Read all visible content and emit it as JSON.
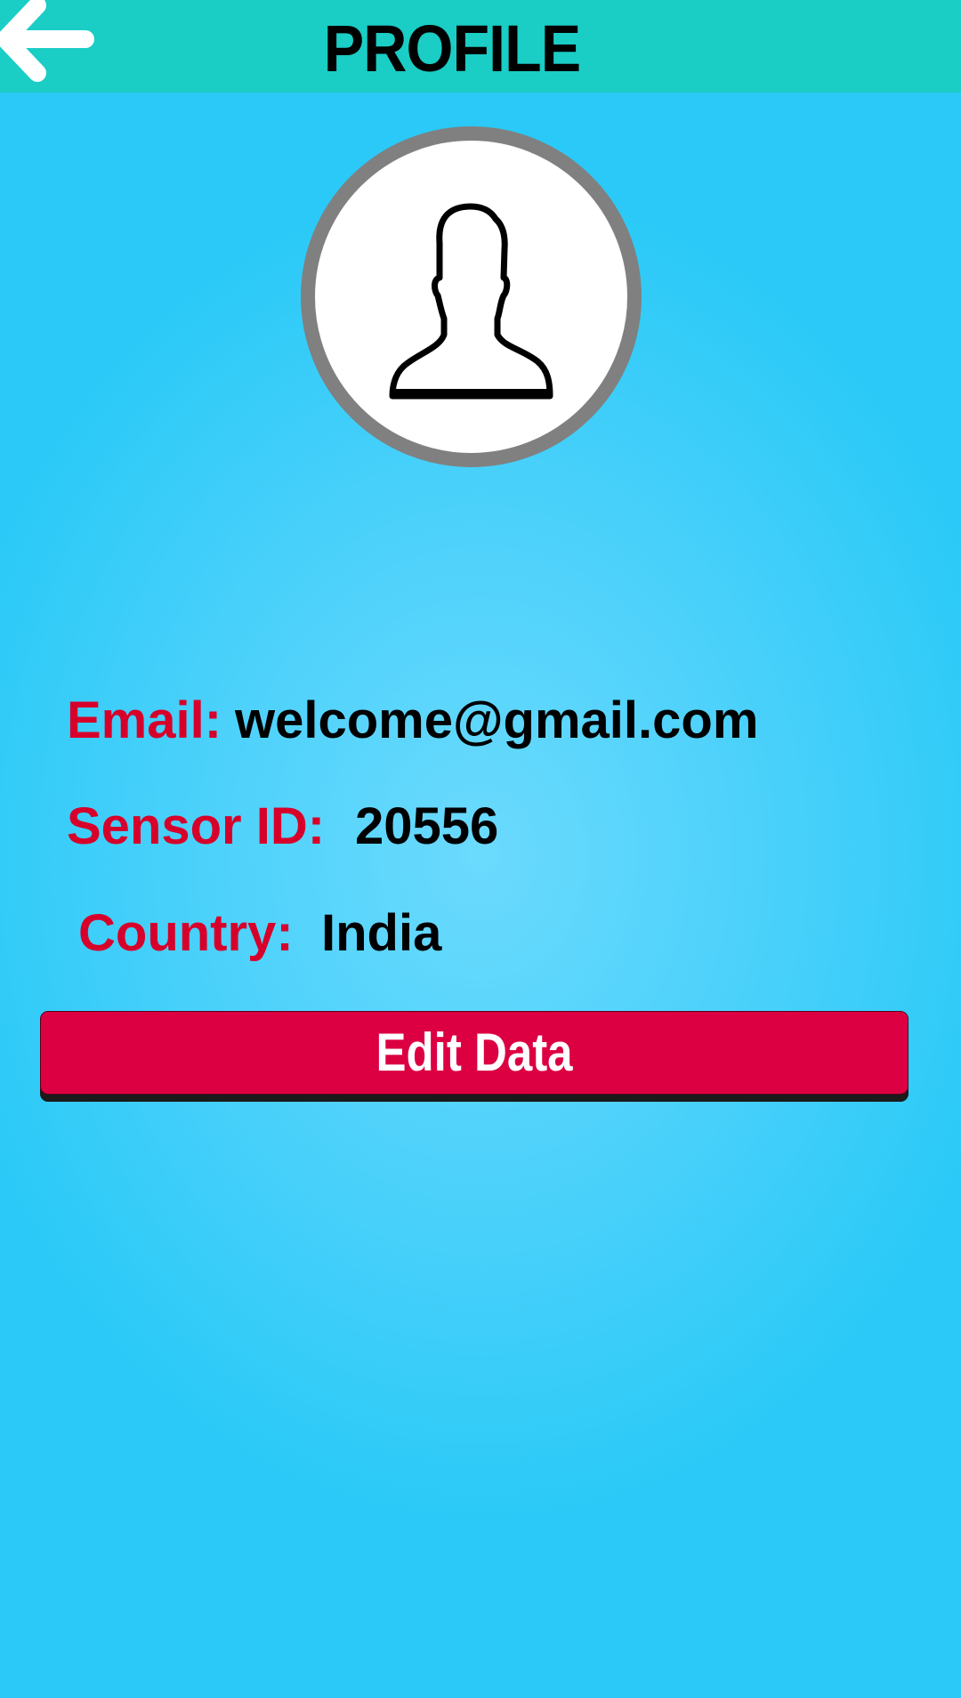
{
  "header": {
    "title": "PROFILE",
    "back_icon": "arrow-left-icon"
  },
  "avatar": {
    "icon": "user-silhouette-icon"
  },
  "fields": [
    {
      "label": "Email:",
      "value": "welcome@gmail.com"
    },
    {
      "label": "Sensor ID:",
      "value": "20556"
    },
    {
      "label": "Country:",
      "value": "India"
    }
  ],
  "edit_button": {
    "label": "Edit Data"
  },
  "colors": {
    "header": "#1acdc5",
    "label": "#d7002a",
    "button": "#dc0043",
    "background": "#2ac9f7"
  }
}
